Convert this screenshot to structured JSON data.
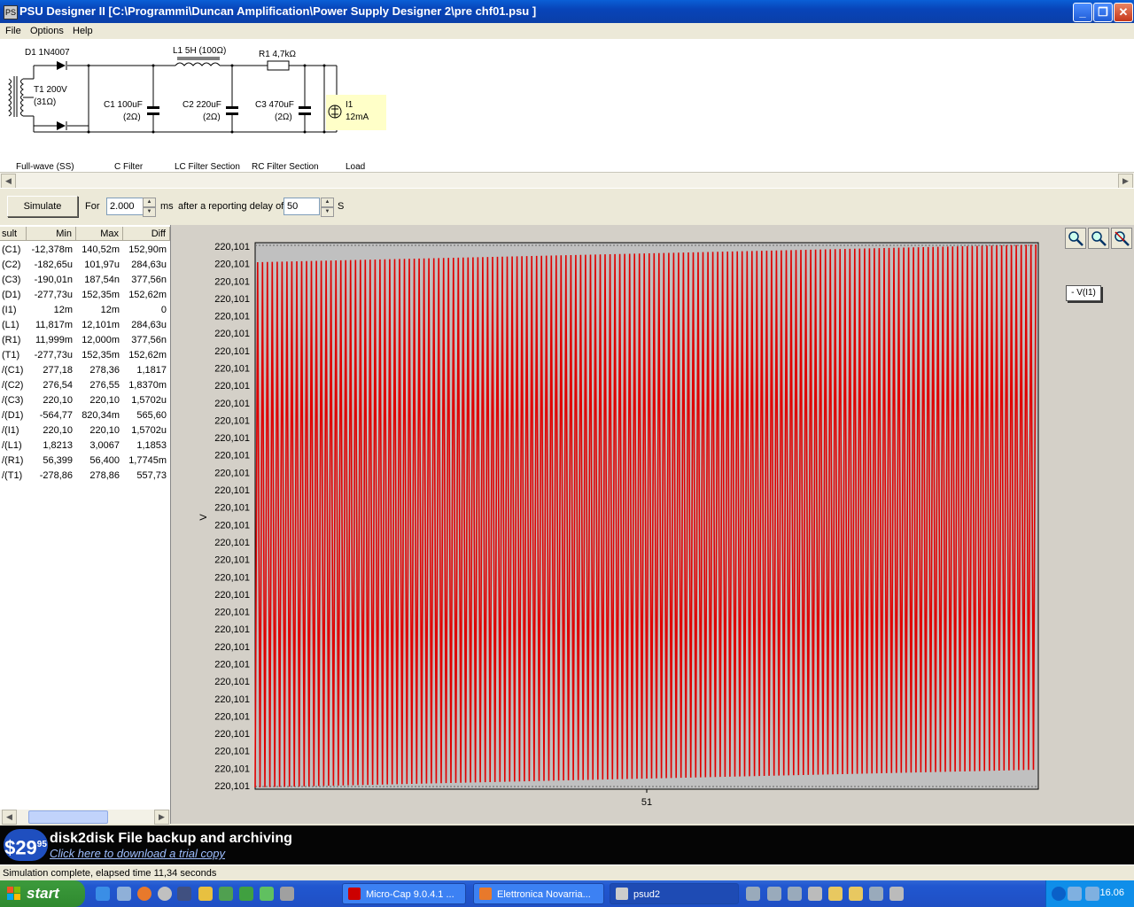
{
  "window": {
    "title": "PSU Designer II  [C:\\Programmi\\Duncan Amplification\\Power Supply Designer 2\\pre chf01.psu ]",
    "icon_label": "PS"
  },
  "menu": [
    "File",
    "Options",
    "Help"
  ],
  "schematic": {
    "d1": "D1 1N4007",
    "t1_line1": "T1 200V",
    "t1_line2": "(31Ω)",
    "l1": "L1 5H (100Ω)",
    "r1": "R1 4,7kΩ",
    "c1_line1": "C1 100uF",
    "c1_line2": "(2Ω)",
    "c2_line1": "C2 220uF",
    "c2_line2": "(2Ω)",
    "c3_line1": "C3 470uF",
    "c3_line2": "(2Ω)",
    "i1_line1": "I1",
    "i1_line2": "12mA",
    "sections": [
      "Full-wave (SS)",
      "C Filter",
      "LC Filter Section",
      "RC Filter Section",
      "Load"
    ]
  },
  "toolbar": {
    "simulate_label": "Simulate",
    "for_label": "For",
    "duration_value": "2.000",
    "duration_unit": "ms",
    "delay_label": "after a reporting delay of",
    "delay_value": "50",
    "delay_unit": "S"
  },
  "results": {
    "headers": [
      "sult",
      "Min",
      "Max",
      "Diff"
    ],
    "rows": [
      [
        "(C1)",
        "-12,378m",
        "140,52m",
        "152,90m"
      ],
      [
        "(C2)",
        "-182,65u",
        "101,97u",
        "284,63u"
      ],
      [
        "(C3)",
        "-190,01n",
        "187,54n",
        "377,56n"
      ],
      [
        "(D1)",
        "-277,73u",
        "152,35m",
        "152,62m"
      ],
      [
        "(I1)",
        "12m",
        "12m",
        "0"
      ],
      [
        "(L1)",
        "11,817m",
        "12,101m",
        "284,63u"
      ],
      [
        "(R1)",
        "11,999m",
        "12,000m",
        "377,56n"
      ],
      [
        "(T1)",
        "-277,73u",
        "152,35m",
        "152,62m"
      ],
      [
        "/(C1)",
        "277,18",
        "278,36",
        "1,1817"
      ],
      [
        "/(C2)",
        "276,54",
        "276,55",
        "1,8370m"
      ],
      [
        "/(C3)",
        "220,10",
        "220,10",
        "1,5702u"
      ],
      [
        "/(D1)",
        "-564,77",
        "820,34m",
        "565,60"
      ],
      [
        "/(I1)",
        "220,10",
        "220,10",
        "1,5702u"
      ],
      [
        "/(L1)",
        "1,8213",
        "3,0067",
        "1,1853"
      ],
      [
        "/(R1)",
        "56,399",
        "56,400",
        "1,7745m"
      ],
      [
        "/(T1)",
        "-278,86",
        "278,86",
        "557,73"
      ]
    ]
  },
  "chart_data": {
    "type": "line",
    "ylabel": "V",
    "xtick_labels": [
      "51"
    ],
    "ytick_labels": [
      "220,101",
      "220,101",
      "220,101",
      "220,101",
      "220,101",
      "220,101",
      "220,101",
      "220,101",
      "220,101",
      "220,101",
      "220,101",
      "220,101",
      "220,101",
      "220,101",
      "220,101",
      "220,101",
      "220,101",
      "220,101",
      "220,101",
      "220,101",
      "220,101",
      "220,101",
      "220,101",
      "220,101",
      "220,101",
      "220,101",
      "220,101",
      "220,101",
      "220,101",
      "220,101",
      "220,101",
      "220,101"
    ],
    "series": [
      {
        "name": "- V(I1)",
        "color": "#e00000"
      }
    ],
    "cycles": 160,
    "grid": false
  },
  "colors": {
    "trace": "#e00000",
    "load_box": "#ffffc8"
  },
  "ad": {
    "price_main": "29",
    "price_sup": "95",
    "headline": "disk2disk File backup and archiving",
    "link": "Click here to download a trial copy"
  },
  "status": "Simulation complete, elapsed time 11,34 seconds",
  "taskbar": {
    "start_label": "start",
    "tasks": [
      "Micro-Cap 9.0.4.1 ...",
      "Elettronica Novarria...",
      "psud2"
    ],
    "clock": "16.06"
  }
}
